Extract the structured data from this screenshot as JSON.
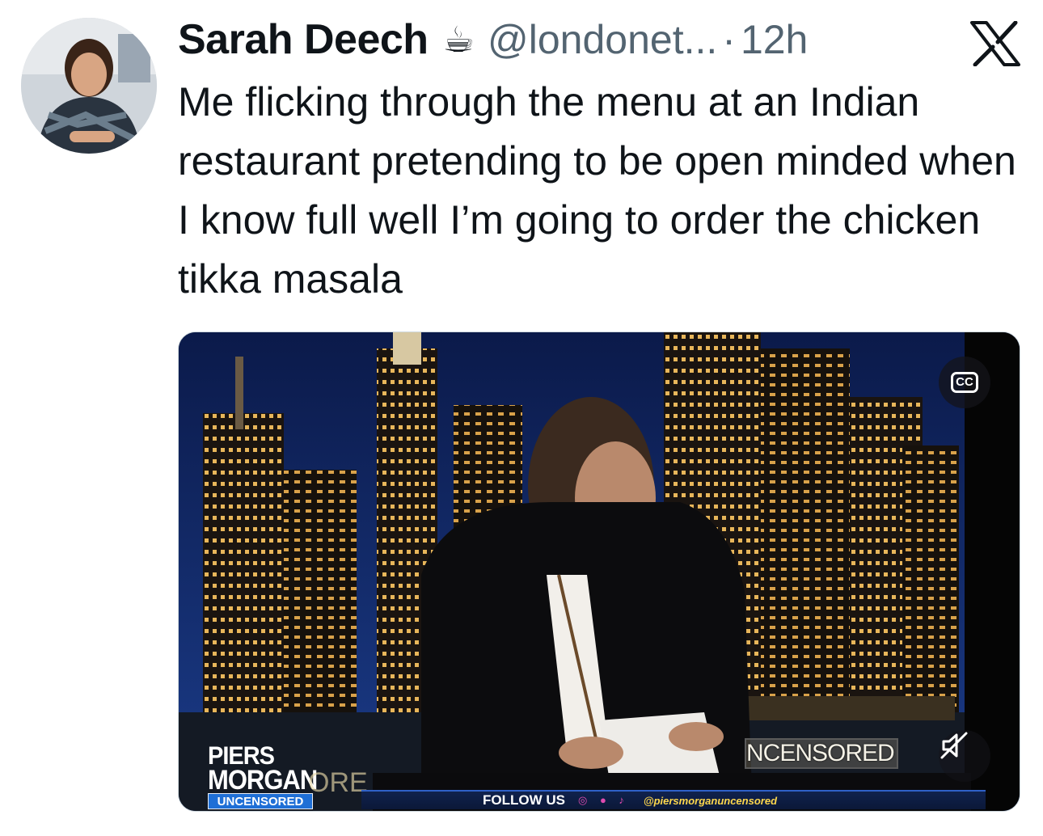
{
  "tweet": {
    "display_name": "Sarah Deech",
    "name_emoji": "☕",
    "handle": "@londonet...",
    "separator": "·",
    "timestamp": "12h",
    "text": "Me flicking through the menu at an Indian restaurant pretending to be open minded when I know full well I’m going to order the chicken tikka masala",
    "platform_icon": "x-logo-icon",
    "avatar_icon": "profile-photo"
  },
  "media": {
    "cc_label": "CC",
    "mute_icon": "speaker-muted-icon",
    "overlay": {
      "logo_line1": "PIERS",
      "logo_line2": "MORGAN",
      "logo_badge": "UNCENSORED",
      "partial_text": "ORE",
      "banner": "NCENSORED",
      "ticker_follow": "FOLLOW US",
      "ticker_icons": "◎ ● ♪",
      "ticker_handle": "@piersmorganuncensored"
    },
    "colors": {
      "sky": "#0e1f5a",
      "ticker": "#10224e",
      "badge": "#1f6fd6"
    }
  }
}
